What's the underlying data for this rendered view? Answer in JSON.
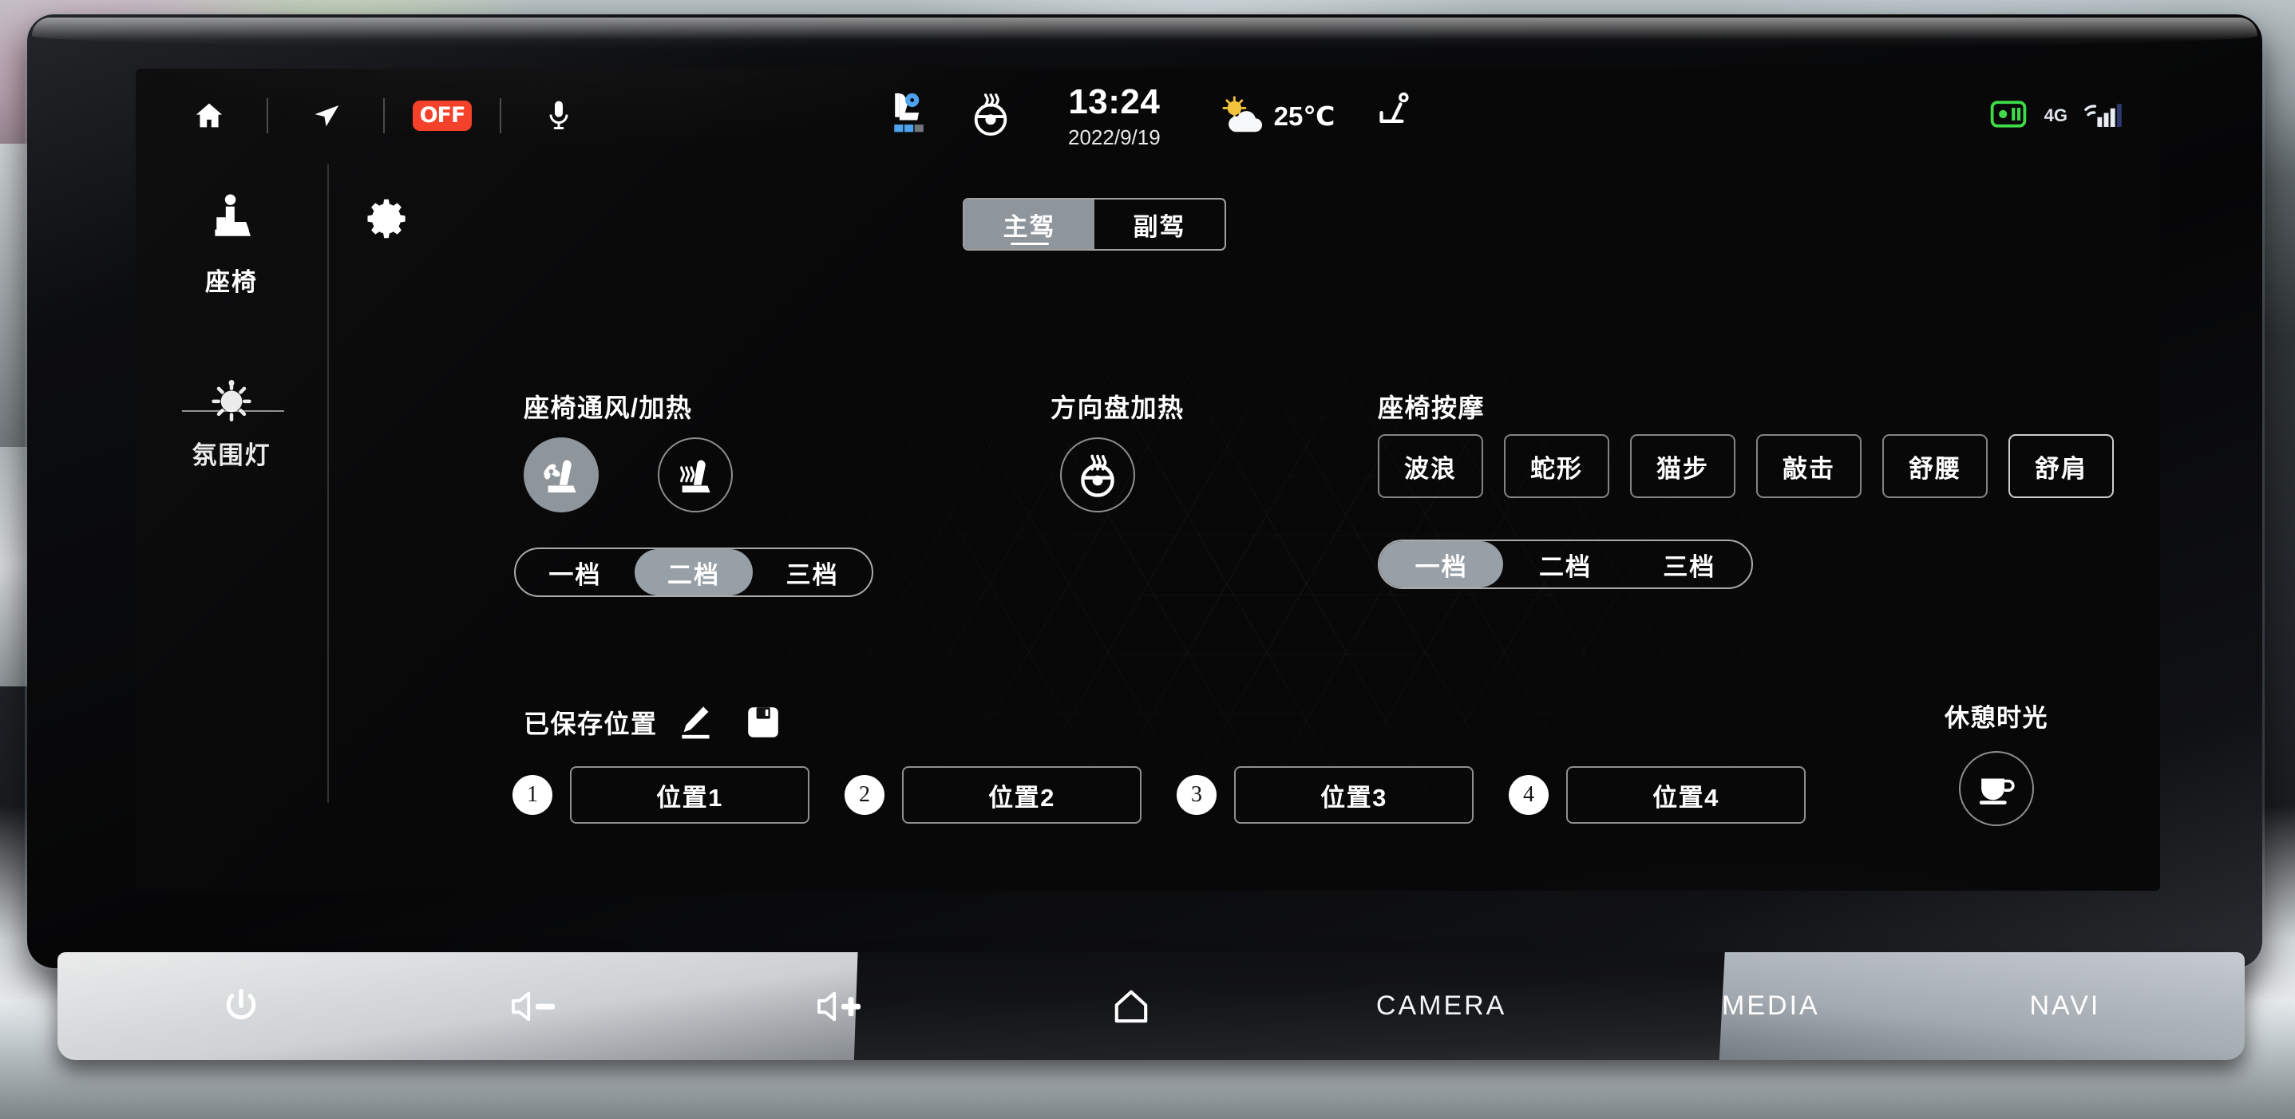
{
  "status_bar": {
    "left_icons": [
      {
        "name": "home-icon",
        "label": "Home"
      },
      {
        "name": "navigation-arrow-icon",
        "label": "Navigation"
      },
      {
        "name": "off-badge-icon",
        "label": "OFF"
      },
      {
        "name": "microphone-icon",
        "label": "Voice"
      }
    ],
    "off_badge_text": "OFF",
    "center_icons": [
      {
        "name": "seat-ventilation-status-icon",
        "label": "Seat ventilation",
        "level": 2,
        "levels": 3,
        "color": "#4da3f0"
      },
      {
        "name": "steering-wheel-heat-status-icon",
        "label": "Steering wheel heat"
      }
    ],
    "clock": {
      "time": "13:24",
      "date": "2022/9/19"
    },
    "weather": {
      "icon": "sun-cloud-icon",
      "temperature": "25℃"
    },
    "seat_icon": {
      "name": "seat-status-icon",
      "label": "Seat"
    },
    "right_icons": [
      {
        "name": "hotspot-icon",
        "label": "Hotspot",
        "color": "#3ddc48"
      },
      {
        "name": "cellular-signal-icon",
        "label": "4G signal",
        "network": "4G",
        "bars": 4
      }
    ]
  },
  "sidebar": {
    "items": [
      {
        "id": "seat",
        "label": "座椅",
        "icon": "seat-icon",
        "active": true
      },
      {
        "id": "ambient-light",
        "label": "氛围灯",
        "icon": "ambient-light-icon",
        "active": false
      }
    ]
  },
  "settings_button": {
    "icon": "gear-icon",
    "label": "设置"
  },
  "tabs": [
    {
      "id": "driver",
      "label": "主驾",
      "active": true
    },
    {
      "id": "passenger",
      "label": "副驾",
      "active": false
    }
  ],
  "seat_climate": {
    "title": "座椅通风/加热",
    "buttons": [
      {
        "id": "ventilation",
        "icon": "seat-ventilation-icon",
        "label": "通风",
        "active": true
      },
      {
        "id": "heating",
        "icon": "seat-heating-icon",
        "label": "加热",
        "active": false
      }
    ],
    "levels": [
      {
        "label": "一档",
        "active": false
      },
      {
        "label": "二档",
        "active": true
      },
      {
        "label": "三档",
        "active": false
      }
    ]
  },
  "steering_wheel": {
    "title": "方向盘加热",
    "button": {
      "id": "steering-heat",
      "icon": "steering-wheel-heat-icon",
      "active": false
    }
  },
  "massage": {
    "title": "座椅按摩",
    "modes": [
      {
        "label": "波浪",
        "active": false
      },
      {
        "label": "蛇形",
        "active": false
      },
      {
        "label": "猫步",
        "active": false
      },
      {
        "label": "敲击",
        "active": false
      },
      {
        "label": "舒腰",
        "active": false
      },
      {
        "label": "舒肩",
        "active": false
      }
    ],
    "levels": [
      {
        "label": "一档",
        "active": true
      },
      {
        "label": "二档",
        "active": false
      },
      {
        "label": "三档",
        "active": false
      }
    ]
  },
  "saved_positions": {
    "title": "已保存位置",
    "edit_icon": "pencil-edit-icon",
    "save_icon": "floppy-save-icon",
    "items": [
      {
        "number": "1",
        "label": "位置1"
      },
      {
        "number": "2",
        "label": "位置2"
      },
      {
        "number": "3",
        "label": "位置3"
      },
      {
        "number": "4",
        "label": "位置4"
      }
    ]
  },
  "rest_mode": {
    "label": "休憩时光",
    "icon": "coffee-cup-icon"
  },
  "hardware_bar": {
    "buttons": [
      {
        "id": "power",
        "icon": "power-icon",
        "label": ""
      },
      {
        "id": "volume-down",
        "icon": "volume-down-icon",
        "label": ""
      },
      {
        "id": "volume-up",
        "icon": "volume-up-icon",
        "label": ""
      },
      {
        "id": "home",
        "icon": "home-outline-icon",
        "label": ""
      },
      {
        "id": "camera",
        "icon": "",
        "label": "CAMERA"
      },
      {
        "id": "media",
        "icon": "",
        "label": "MEDIA"
      },
      {
        "id": "navi",
        "icon": "",
        "label": "NAVI"
      }
    ]
  },
  "colors": {
    "accent_active": "#8e969c",
    "off_badge": "#f4422a",
    "hotspot_green": "#3ddc48",
    "vent_blue": "#4da3f0",
    "screen_bg": "#080809"
  }
}
